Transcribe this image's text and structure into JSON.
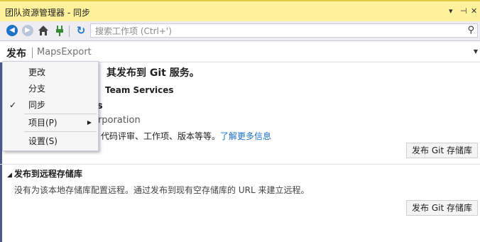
{
  "window": {
    "title": "团队资源管理器 - 同步",
    "buttons": [
      "▾",
      "⊣",
      "✕"
    ]
  },
  "toolbar": {
    "search_placeholder": "搜索工作项 (Ctrl+')"
  },
  "header": {
    "page": "发布",
    "repo": "MapsExport"
  },
  "menu": {
    "items": [
      {
        "label": "更改",
        "checked": false,
        "submenu": false
      },
      {
        "label": "分支",
        "checked": false,
        "submenu": false
      },
      {
        "label": "同步",
        "checked": true,
        "submenu": false
      },
      {
        "label": "项目(P)",
        "checked": false,
        "submenu": true
      },
      {
        "label": "设置(S)",
        "checked": false,
        "submenu": false
      }
    ]
  },
  "main": {
    "heading": "其发布到 Git 服务。",
    "section_title": "Team Services",
    "service_name": "es",
    "service_sub": "orporation",
    "desc": "、代码评审、工作项、版本等等。",
    "learn_more": "了解更多信息",
    "publish_button": "发布 Git 存储库"
  },
  "remote": {
    "title": "发布到远程存储库",
    "desc": "没有为该本地存储库配置远程。通过发布到现有空存储库的 URL 来建立远程。",
    "publish_button": "发布 Git 存储库"
  }
}
